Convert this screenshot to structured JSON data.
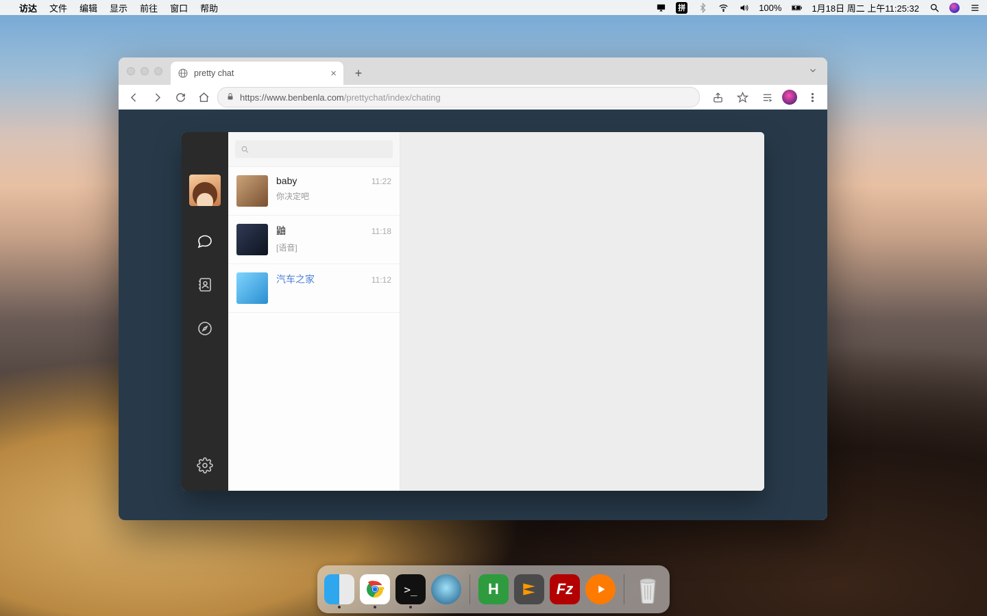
{
  "menubar": {
    "app": "访达",
    "items": [
      "文件",
      "编辑",
      "显示",
      "前往",
      "窗口",
      "帮助"
    ],
    "battery": "100%",
    "date": "1月18日 周二 上午11:25:32",
    "input_method": "拼"
  },
  "browser": {
    "tab_title": "pretty chat",
    "url_host": "https://www.benbenla.com",
    "url_path": "/prettychat/index/chating"
  },
  "chat": {
    "search_placeholder": "",
    "conversations": [
      {
        "name": "baby",
        "time": "11:22",
        "preview": "你决定吧",
        "link": false
      },
      {
        "name": "鼬",
        "time": "11:18",
        "preview": "[语音]",
        "link": false
      },
      {
        "name": "汽车之家",
        "time": "11:12",
        "preview": "",
        "link": true
      }
    ]
  },
  "dock": {
    "apps": [
      "finder",
      "chrome",
      "terminal",
      "quicktime",
      "app-h",
      "sublime",
      "filezilla",
      "player",
      "trash"
    ]
  }
}
